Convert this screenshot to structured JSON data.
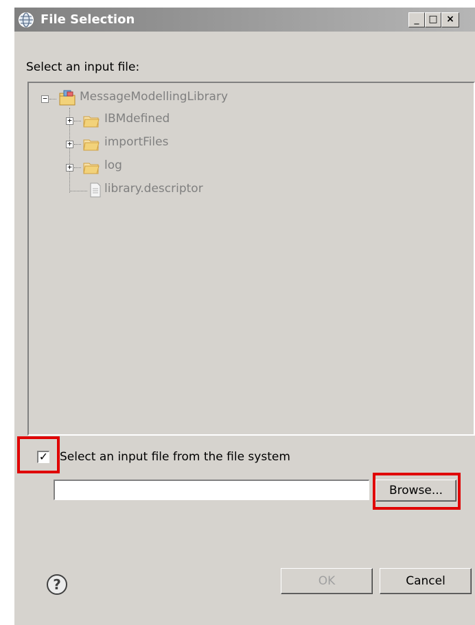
{
  "window": {
    "title": "File Selection",
    "minimize": "_",
    "maximize": "□",
    "close": "×"
  },
  "prompt": "Select an input file:",
  "tree": {
    "root": {
      "label": "MessageModellingLibrary",
      "expander": "−"
    },
    "children": [
      {
        "label": "IBMdefined",
        "type": "folder",
        "expander": "+"
      },
      {
        "label": "importFiles",
        "type": "folder",
        "expander": "+"
      },
      {
        "label": "log",
        "type": "folder",
        "expander": "+"
      },
      {
        "label": "library.descriptor",
        "type": "file"
      }
    ]
  },
  "filesystem_option": {
    "checked": true,
    "check_mark": "✓",
    "label": "Select an input file from the file system"
  },
  "path_input": {
    "value": "",
    "placeholder": ""
  },
  "buttons": {
    "browse": "Browse...",
    "ok": "OK",
    "cancel": "Cancel"
  },
  "colors": {
    "highlight": "#e00000",
    "folder": "#e8c46a",
    "disabled_text": "#808080"
  },
  "icons": {
    "title": "globe-icon",
    "help": "help-icon",
    "folder": "folder-icon",
    "file": "file-icon",
    "project": "project-folder-icon"
  }
}
